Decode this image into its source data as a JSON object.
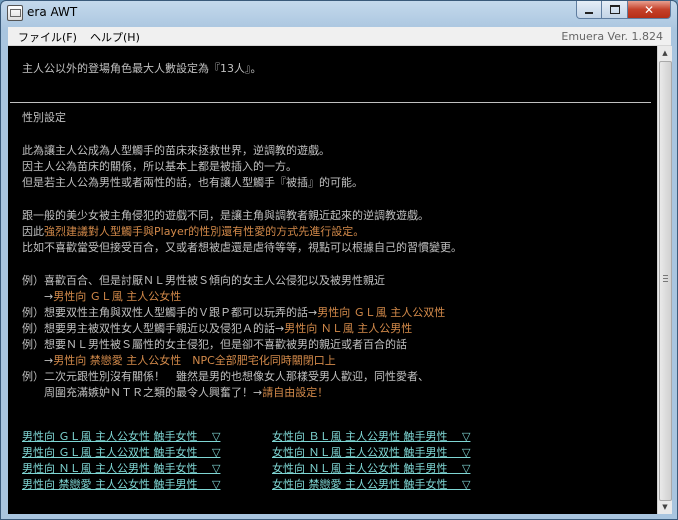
{
  "window": {
    "title": "era AWT",
    "minimize_glyph": "",
    "maximize_glyph": "",
    "close_glyph": "✕"
  },
  "menubar": {
    "file": "ファイル(F)",
    "help": "ヘルプ(H)",
    "version": "Emuera Ver. 1.824"
  },
  "console": {
    "header_line": "主人公以外的登場角色最大人數設定為『13人』。",
    "section_title": "性別設定",
    "para1": [
      "此為讓主人公成為人型觸手的苗床來拯救世界，逆調教的遊戲。",
      "因主人公為苗床的關係，所以基本上都是被插入的一方。",
      "但是若主人公為男性或者兩性的話，也有讓人型觸手『被插』的可能。"
    ],
    "para2_line1": "跟一般的美少女被主角侵犯的遊戲不同，是讓主角與調教者親近起來的逆調教遊戲。",
    "para2_line2_prefix": "因此",
    "para2_line2_highlight": "強烈建議對人型觸手與Player的性別還有性愛的方式先進行設定。",
    "para2_line3": "比如不喜歡當受但接受百合，又或者想被虐還是虐待等等，視點可以根據自己的習慣變更。",
    "examples": [
      {
        "prefix": "例）喜歡百合、但是討厭ＮＬ男性被Ｓ傾向的女主人公侵犯以及被男性親近",
        "highlight": ""
      },
      {
        "prefix": "　　→",
        "highlight": "男性向 ＧＬ風 主人公女性"
      },
      {
        "prefix": "例）想要双性主角與双性人型觸手的Ｖ跟Ｐ都可以玩弄的話→",
        "highlight": "男性向 ＧＬ風 主人公双性"
      },
      {
        "prefix": "例）想要男主被双性女人型觸手親近以及侵犯Ａ的話→",
        "highlight": "男性向 ＮＬ風 主人公男性"
      },
      {
        "prefix": "例）想要ＮＬ男性被Ｓ屬性的女主侵犯，但是卻不喜歡被男的親近或者百合的話",
        "highlight": ""
      },
      {
        "prefix": "　　→",
        "highlight": "男性向 禁戀愛 主人公女性　NPC全部肥宅化同時關閉口上"
      },
      {
        "prefix": "例）二次元跟性別沒有關係！　雖然是男的也想像女人那樣受男人歡迎，同性愛者、",
        "highlight": ""
      },
      {
        "prefix": "　　周圍充滿嫉妒ＮＴＲ之類的最令人興奮了！→",
        "highlight": "請自由設定！"
      }
    ],
    "options_left": [
      "男性向 ＧＬ風 主人公女性 触手女性　 ▽",
      "男性向 ＧＬ風 主人公双性 触手女性　 ▽",
      "男性向 ＮＬ風 主人公男性 触手女性　 ▽",
      "男性向 禁戀愛 主人公女性 触手男性　 ▽"
    ],
    "options_right": [
      "女性向 ＢＬ風 主人公男性 触手男性　 ▽",
      "女性向 ＮＬ風 主人公双性 触手男性　 ▽",
      "女性向 ＮＬ風 主人公女性 触手男性　 ▽",
      "女性向 禁戀愛 主人公男性 触手女性　 ▽"
    ],
    "highlight_color": "#d38a4a",
    "option_color": "#7fd6d4"
  },
  "scrollbar": {
    "up": "▲",
    "down": "▼"
  }
}
